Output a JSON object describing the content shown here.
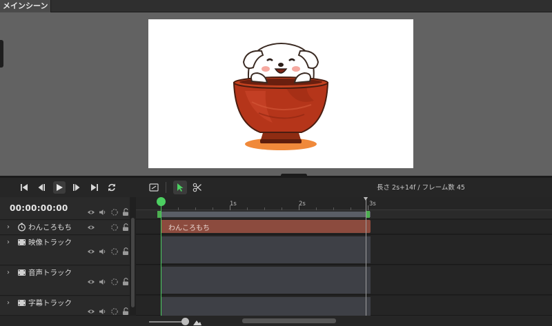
{
  "scene_tab": {
    "label": "メインシーン"
  },
  "preview": {
    "image": "dog-in-bowl-illustration"
  },
  "transport": {
    "buttons": [
      {
        "name": "skip-to-start-icon"
      },
      {
        "name": "step-back-icon"
      },
      {
        "name": "play-icon"
      },
      {
        "name": "step-forward-icon"
      },
      {
        "name": "skip-to-end-icon"
      },
      {
        "name": "loop-icon"
      }
    ]
  },
  "toolbar": {
    "info": "長さ 2s+14f / フレーム数 45",
    "tools": [
      "resize-frame-icon",
      "select-pointer-icon",
      "scissors-icon"
    ]
  },
  "timecode": "00:00:00:00",
  "tracks": [
    {
      "id": "wankoromochi",
      "label": "わんころもち",
      "icon": "clock-icon"
    },
    {
      "id": "video",
      "label": "映像トラック",
      "icon": "film-icon"
    },
    {
      "id": "audio",
      "label": "音声トラック",
      "icon": "film-icon"
    },
    {
      "id": "subtitle",
      "label": "字幕トラック",
      "icon": "film-icon"
    }
  ],
  "ruler": {
    "labels": [
      "1s",
      "2s",
      "3s"
    ]
  },
  "clip": {
    "label": "わんころもち"
  },
  "colors": {
    "playhead": "#4ccf61",
    "clip": "#8c4b3e",
    "accent_green": "#4caf50"
  }
}
